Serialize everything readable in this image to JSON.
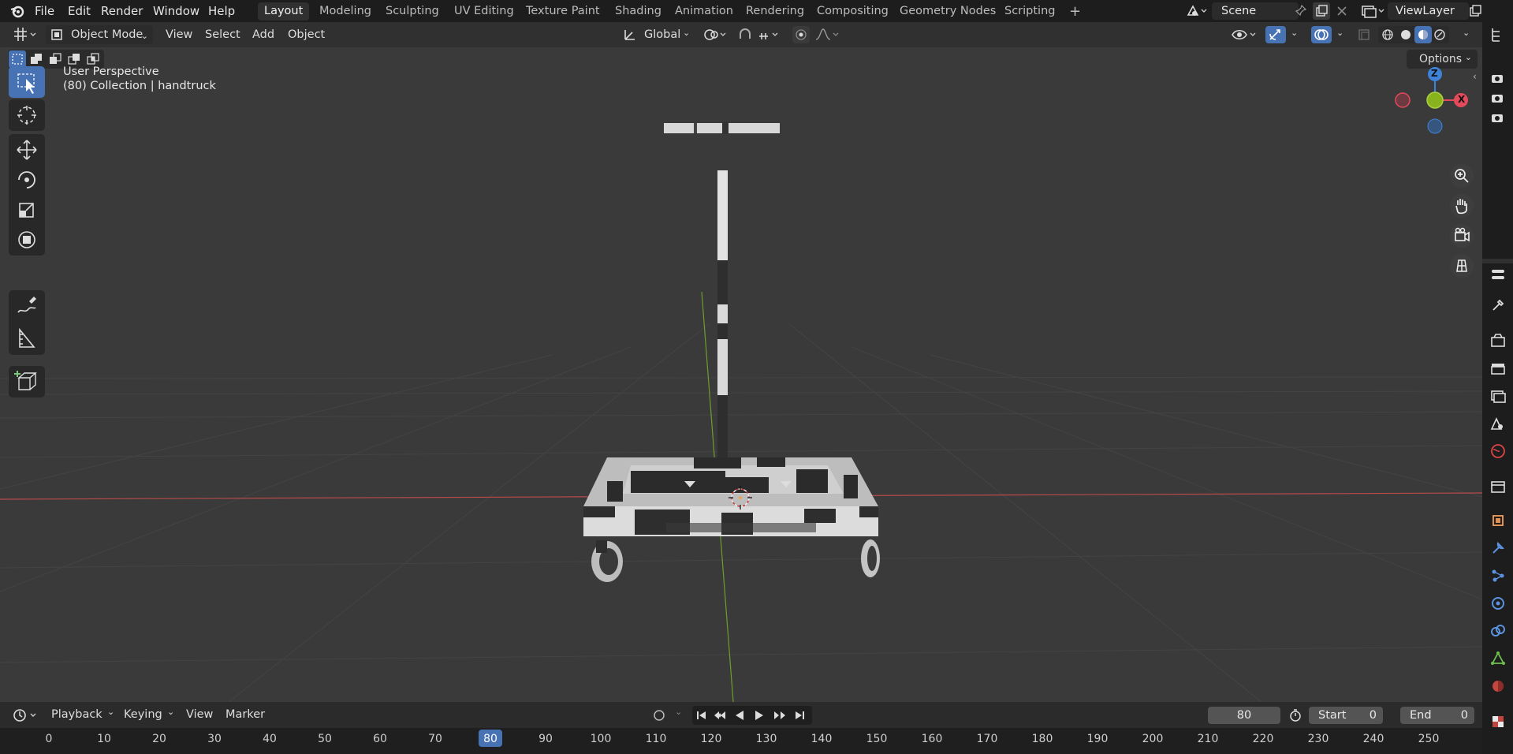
{
  "top_menu": {
    "items": [
      "File",
      "Edit",
      "Render",
      "Window",
      "Help"
    ]
  },
  "workspaces": {
    "tabs": [
      "Layout",
      "Modeling",
      "Sculpting",
      "UV Editing",
      "Texture Paint",
      "Shading",
      "Animation",
      "Rendering",
      "Compositing",
      "Geometry Nodes",
      "Scripting"
    ],
    "active": "Layout",
    "add_symbol": "+"
  },
  "scene": {
    "name": "Scene"
  },
  "view_layer": {
    "name": "ViewLayer"
  },
  "viewport_header": {
    "mode": "Object Mode",
    "menus": [
      "View",
      "Select",
      "Add",
      "Object"
    ],
    "orientation": "Global",
    "options_label": "Options"
  },
  "viewport_overlay": {
    "perspective": "User Perspective",
    "collection": "(80) Collection | handtruck"
  },
  "gizmo": {
    "z_label": "Z",
    "x_label": "X",
    "colors": {
      "x": "#e34a5c",
      "y": "#88b31d",
      "z": "#3f82d9"
    }
  },
  "timeline": {
    "menus": [
      "Playback",
      "Keying",
      "View",
      "Marker"
    ],
    "current_frame": "80",
    "start_label": "Start",
    "start_value": "0",
    "end_label": "End",
    "end_value": "0",
    "ruler_ticks": [
      "0",
      "10",
      "20",
      "30",
      "40",
      "50",
      "60",
      "70",
      "80",
      "90",
      "100",
      "110",
      "120",
      "130",
      "140",
      "150",
      "160",
      "170",
      "180",
      "190",
      "200",
      "210",
      "220",
      "230",
      "240",
      "250"
    ]
  },
  "colors": {
    "accent": "#4772b3",
    "x_axis_line": "#b94a4a",
    "y_axis_line": "#6f9e2a"
  }
}
